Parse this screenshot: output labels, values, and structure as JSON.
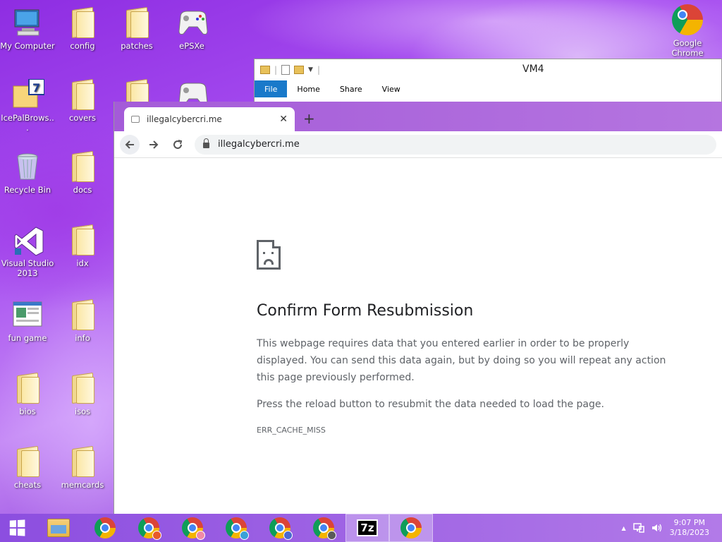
{
  "desktop": {
    "icons": [
      {
        "label": "My Computer"
      },
      {
        "label": "config"
      },
      {
        "label": "patches"
      },
      {
        "label": "ePSXe"
      },
      {
        "label": "IcePalBrows..."
      },
      {
        "label": "covers"
      },
      {
        "label": "Recycle Bin"
      },
      {
        "label": "docs"
      },
      {
        "label": "Visual Studio 2013"
      },
      {
        "label": "idx"
      },
      {
        "label": "fun game"
      },
      {
        "label": "info"
      },
      {
        "label": "bios"
      },
      {
        "label": "isos"
      },
      {
        "label": "cheats"
      },
      {
        "label": "memcards"
      },
      {
        "label": "Google Chrome"
      }
    ]
  },
  "explorer": {
    "title": "VM4",
    "ribbon_tabs": [
      "File",
      "Home",
      "Share",
      "View"
    ]
  },
  "chrome": {
    "tab_title": "illegalcybercri.me",
    "new_tab": "+",
    "tab_close": "✕",
    "url": "illegalcybercri.me"
  },
  "error": {
    "title": "Confirm Form Resubmission",
    "paragraph1": "This webpage requires data that you entered earlier in order to be properly displayed. You can send this data again, but by doing so you will repeat any action this page previously performed.",
    "paragraph2": "Press the reload button to resubmit the data needed to load the page.",
    "code": "ERR_CACHE_MISS"
  },
  "taskbar": {
    "time": "9:07 PM",
    "date": "3/18/2023",
    "sevenzip_label": "7z",
    "tray_expand": "▲"
  },
  "colors": {
    "accent": "#1979ca",
    "taskbar": "#9b5fe3"
  }
}
